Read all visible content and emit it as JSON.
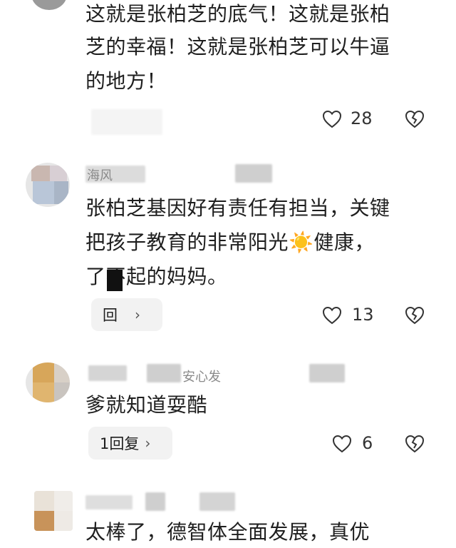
{
  "comments": [
    {
      "text_lines": [
        "这就是张柏芝的底气！这就是张柏",
        "芝的幸福！这就是张柏芝可以牛逼",
        "的地方！"
      ],
      "likes": "28"
    },
    {
      "username_partial": "海风",
      "text_lines": [
        "张柏芝基因好有责任有担当，关键",
        "把孩子教育的非常阳光☀️健康，",
        "了不起的妈妈。"
      ],
      "reply_label": "回",
      "likes": "13"
    },
    {
      "username_partial": "安心发",
      "text_lines": [
        "爹就知道耍酷"
      ],
      "reply_label": "1回复",
      "likes": "6"
    },
    {
      "text_lines": [
        "太棒了，德智体全面发展，真优"
      ]
    }
  ],
  "icons": {
    "like": "heart-icon",
    "dislike": "broken-heart-icon",
    "more": "chevron-right-icon"
  }
}
